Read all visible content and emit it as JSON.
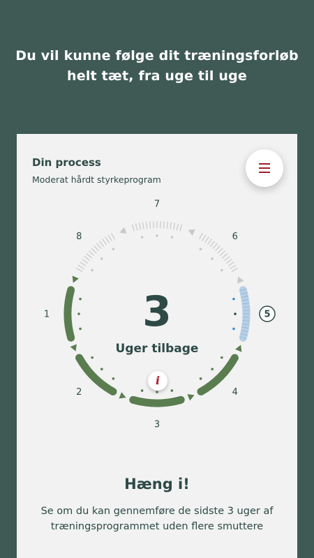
{
  "headline": {
    "line1": "Du vil kunne følge dit træningsforløb",
    "line2": "helt tæt, fra uge til uge"
  },
  "card": {
    "title": "Din process",
    "subtitle": "Moderat hårdt styrkeprogram",
    "menu_icon": "hamburger-menu-icon"
  },
  "progress": {
    "weeks_left": "3",
    "weeks_left_label": "Uger tilbage",
    "total_weeks": 8,
    "completed_weeks": 4,
    "current_week": 5,
    "week_labels": [
      "1",
      "2",
      "3",
      "4",
      "5",
      "6",
      "7",
      "8"
    ],
    "info_icon": "i",
    "colors": {
      "completed": "#5a7d4f",
      "current": "#b7d0e6",
      "current_dot": "#3a8ed6",
      "upcoming": "#c8c8c8",
      "text": "#2e4a46",
      "accent": "#a51c2a"
    }
  },
  "cta": {
    "title": "Hæng i!",
    "text": "Se om du kan gennemføre de sidste 3 uger af træningsprogrammet uden flere smuttere"
  }
}
